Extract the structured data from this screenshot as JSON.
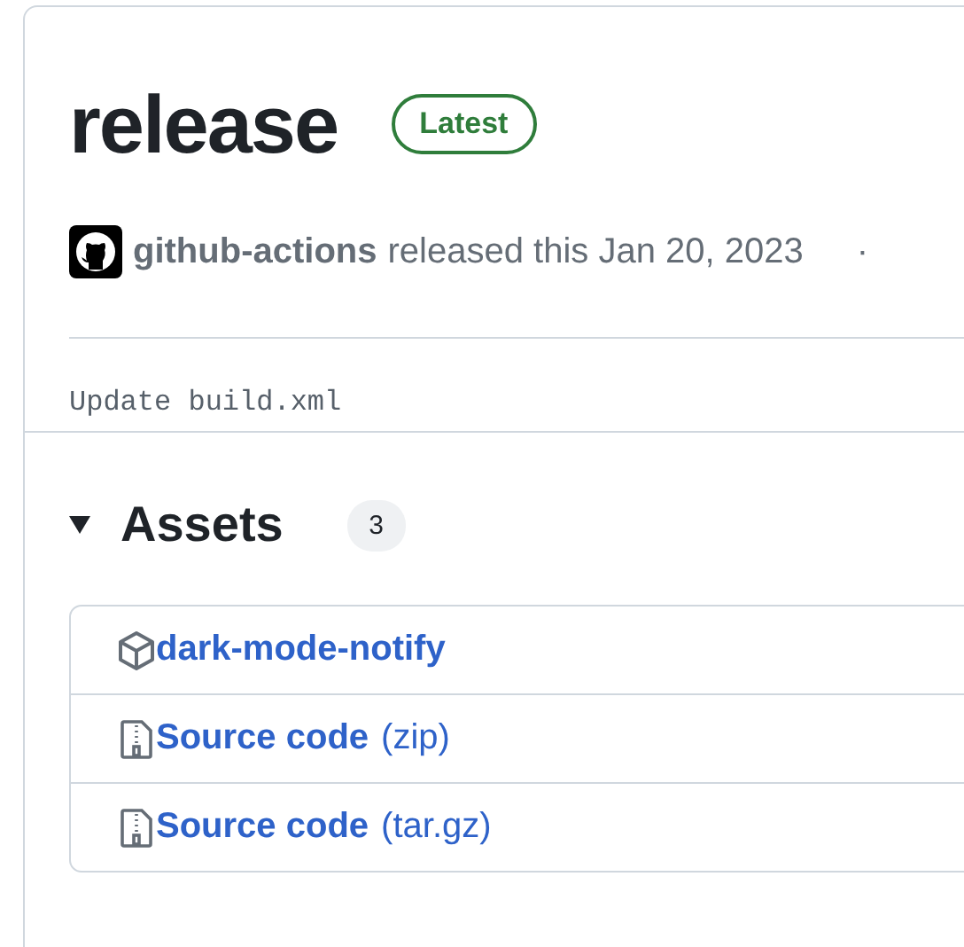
{
  "release": {
    "title": "release",
    "badge": "Latest",
    "author": "github-actions",
    "action": "released this Jan 20, 2023",
    "separator": "·",
    "body": "Update build.xml"
  },
  "assets": {
    "title": "Assets",
    "expanded": true,
    "count": "3",
    "items": [
      {
        "kind": "package",
        "name": "dark-mode-notify"
      },
      {
        "kind": "archive",
        "name": "Source code",
        "suffix": "(zip)"
      },
      {
        "kind": "archive",
        "name": "Source code",
        "suffix": "(tar.gz)"
      }
    ]
  }
}
